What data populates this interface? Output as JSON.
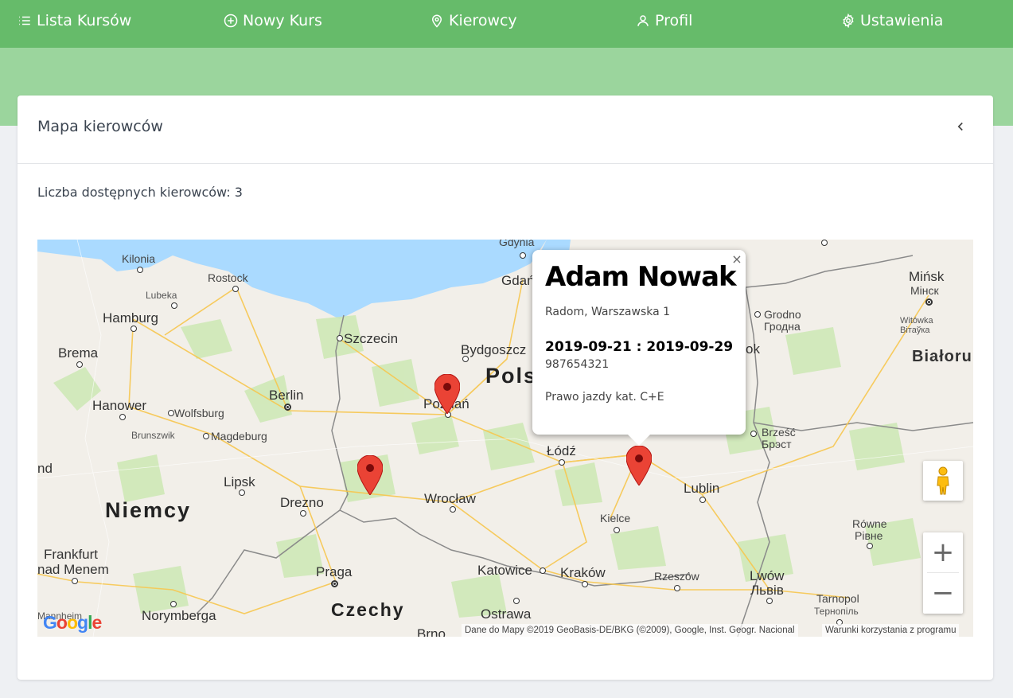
{
  "nav": {
    "items": [
      {
        "label": "Lista Kursów",
        "icon": "list-icon"
      },
      {
        "label": "Nowy Kurs",
        "icon": "plus-circle-icon"
      },
      {
        "label": "Kierowcy",
        "icon": "map-pin-icon"
      },
      {
        "label": "Profil",
        "icon": "user-icon"
      },
      {
        "label": "Ustawienia",
        "icon": "gear-icon"
      }
    ]
  },
  "card": {
    "title": "Mapa kierowców",
    "count_text": "Liczba dostępnych kierowców: 3"
  },
  "map": {
    "labels": {
      "gdynia": "Gdynia",
      "kilonia": "Kilonia",
      "rostock": "Rostock",
      "lubeka": "Lubeka",
      "hamburg": "Hamburg",
      "brema": "Brema",
      "hanower": "Hanower",
      "wolfsburg": "Wolfsburg",
      "brunszwik": "Brunszwik",
      "magdeburg": "Magdeburg",
      "berlin": "Berlin",
      "szczecin": "Szczecin",
      "gdansk": "Gdań",
      "bydgoszcz": "Bydgoszcz",
      "polska": "Pols",
      "poznan": "Poznań",
      "lipsk": "Lipsk",
      "drezno": "Drezno",
      "wroclaw": "Wrocław",
      "lodz": "Łódź",
      "niemcy": "Niemcy",
      "nd": "nd",
      "frankfurt": "Frankfurt",
      "nad_menem": "nad Menem",
      "praga": "Praga",
      "katowice": "Katowice",
      "krakow": "Kraków",
      "kielce": "Kielce",
      "lublin": "Lublin",
      "rzeszow": "Rzeszów",
      "czechy": "Czechy",
      "ostrawa": "Ostrawa",
      "brno": "Brno",
      "norymberga": "Norymberga",
      "mannheim": "Mannheim",
      "minsk": "Mińsk",
      "minsk_be": "Мінск",
      "grodno": "Grodno",
      "grodno_be": "Гродна",
      "witowka": "Witówka",
      "witowka_be": "Вітаўка",
      "ok": "ok",
      "bialorus": "Białoru",
      "brzesc": "Brześć",
      "brzesc_be": "Брэст",
      "rowne": "Równe",
      "rowne_uk": "Рівне",
      "lwow": "Lwów",
      "lwow_uk": "Львів",
      "tarnopol": "Tarnopol",
      "tarnopol_uk": "Тернопіль"
    },
    "infowindow": {
      "name": "Adam Nowak",
      "address": "Radom, Warszawska 1",
      "dates": "2019-09-21 : 2019-09-29",
      "phone": "987654321",
      "license": "Prawo jazdy kat. C+E"
    },
    "logo": "Google",
    "attribution": "Dane do Mapy ©2019 GeoBasis-DE/BKG (©2009), Google, Inst. Geogr. Nacional",
    "terms": "Warunki korzystania z programu",
    "zoom_in": "+",
    "zoom_out": "−",
    "close": "×",
    "marker_color": "#ea4335"
  },
  "colors": {
    "nav_bg": "#66bb6a",
    "hero_bg": "#9bd59d",
    "water": "#aadaff",
    "land": "#f2efe9",
    "forest": "#cde8b4"
  }
}
